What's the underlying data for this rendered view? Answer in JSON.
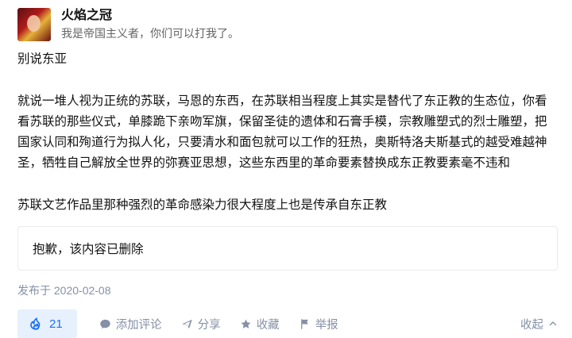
{
  "author": {
    "name": "火焰之冠",
    "bio": "我是帝国主义者，你们可以打我了。"
  },
  "content": {
    "paragraphs": [
      "别说东亚",
      "就说一堆人视为正统的苏联，马恩的东西，在苏联相当程度上其实是替代了东正教的生态位，你看看苏联的那些仪式，单膝跪下亲吻军旗，保留圣徒的遗体和石膏手模，宗教雕塑式的烈士雕塑，把国家认同和殉道行为拟人化，只要清水和面包就可以工作的狂热，奥斯特洛夫斯基式的越受难越神圣，牺牲自己解放全世界的弥赛亚思想，这些东西里的革命要素替换成东正教要素毫不违和",
      "苏联文艺作品里那种强烈的革命感染力很大程度上也是传承自东正教"
    ]
  },
  "deleted_notice": "抱歉，该内容已删除",
  "published_date": "发布于 2020-02-08",
  "actions": {
    "like_count": "21",
    "add_comment": "添加评论",
    "share": "分享",
    "favorite": "收藏",
    "report": "举报",
    "collapse": "收起"
  },
  "colors": {
    "accent": "#1772f6",
    "like_bg": "#e7f0fd",
    "muted": "#8590a6",
    "text": "#121212"
  },
  "icons": {
    "like": "like-icon",
    "comment": "comment-icon",
    "share": "share-icon",
    "favorite": "star-icon",
    "report": "flag-icon",
    "collapse": "chevron-up-icon"
  }
}
